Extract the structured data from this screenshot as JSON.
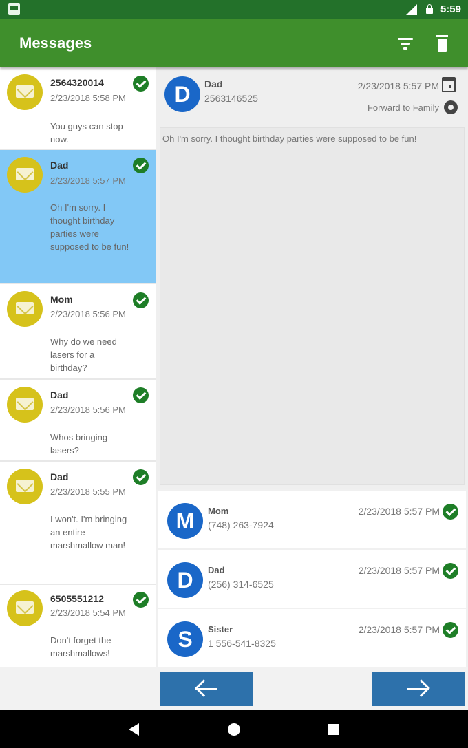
{
  "status_bar": {
    "time": "5:59"
  },
  "app_bar": {
    "title": "Messages",
    "filter_icon": "filter-icon",
    "delete_icon": "trash-icon"
  },
  "message_list": [
    {
      "sender": "2564320014",
      "date": "2/23/2018 5:58 PM",
      "preview": "You guys can stop now.",
      "status": "sent"
    },
    {
      "sender": "Dad",
      "date": "2/23/2018 5:57 PM",
      "preview": "Oh I'm sorry. I thought birthday parties were supposed to be fun!",
      "status": "sent",
      "selected": true
    },
    {
      "sender": "Mom",
      "date": "2/23/2018 5:56 PM",
      "preview": "Why do we need lasers for a birthday?",
      "status": "sent"
    },
    {
      "sender": "Dad",
      "date": "2/23/2018 5:56 PM",
      "preview": "Whos bringing lasers?",
      "status": "sent"
    },
    {
      "sender": "Dad",
      "date": "2/23/2018 5:55 PM",
      "preview": "I won't. I'm bringing an entire marshmallow man!",
      "status": "sent"
    },
    {
      "sender": "6505551212",
      "date": "2/23/2018 5:54 PM",
      "preview": "Don't forget the marshmallows!",
      "status": "sent"
    }
  ],
  "detail": {
    "avatar_letter": "D",
    "sender": "Dad",
    "phone": "2563146525",
    "date": "2/23/2018 5:57 PM",
    "forward_label": "Forward to Family",
    "body": "Oh I'm sorry. I thought birthday parties were supposed to be fun!"
  },
  "recipients": [
    {
      "letter": "M",
      "name": "Mom",
      "phone": "(748) 263-7924",
      "date": "2/23/2018 5:57 PM"
    },
    {
      "letter": "D",
      "name": "Dad",
      "phone": "(256) 314-6525",
      "date": "2/23/2018 5:57 PM"
    },
    {
      "letter": "S",
      "name": "Sister",
      "phone": "1 556-541-8325",
      "date": "2/23/2018 5:57 PM"
    }
  ],
  "colors": {
    "app_bar": "#3f8f2c",
    "status_bar": "#23712a",
    "selected_row": "#82c8f6",
    "envelope": "#d6c21b",
    "avatar": "#1a67c8",
    "check": "#1e7e27",
    "nav_button": "#2d71ab"
  }
}
